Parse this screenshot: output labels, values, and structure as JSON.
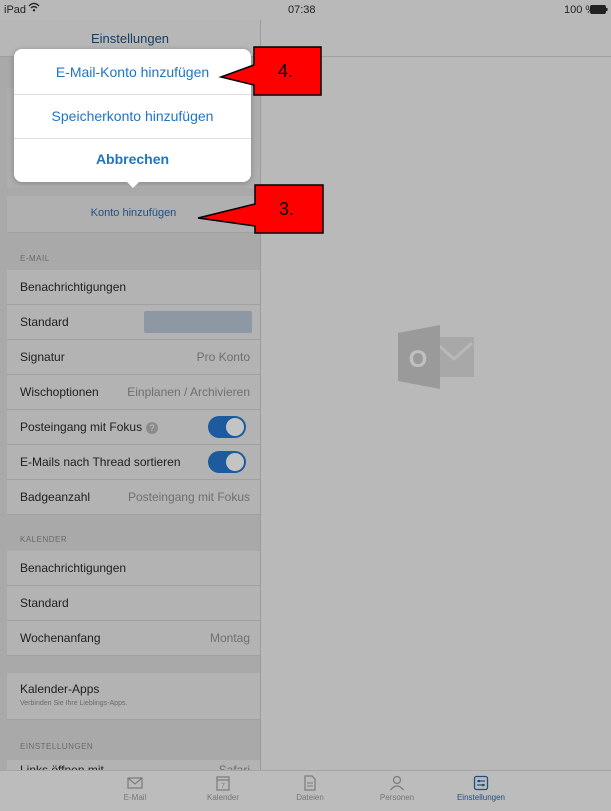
{
  "status_bar": {
    "device": "iPad",
    "time": "07:38",
    "battery": "100 %"
  },
  "header": {
    "title": "Einstellungen"
  },
  "popover": {
    "options": [
      "E-Mail-Konto hinzufügen",
      "Speicherkonto hinzufügen"
    ],
    "cancel": "Abbrechen"
  },
  "add_account": {
    "label": "Konto hinzufügen"
  },
  "email_section": {
    "title": "E-MAIL",
    "rows": {
      "notifications": "Benachrichtigungen",
      "default": "Standard",
      "signature": "Signatur",
      "signature_value": "Pro Konto",
      "swipe": "Wischoptionen",
      "swipe_value": "Einplanen / Archivieren",
      "focused": "Posteingang mit Fokus",
      "thread": "E-Mails nach Thread sortieren",
      "badge": "Badgeanzahl",
      "badge_value": "Posteingang mit Fokus"
    },
    "focused_enabled": true,
    "thread_enabled": true
  },
  "calendar_section": {
    "title": "KALENDER",
    "rows": {
      "notifications": "Benachrichtigungen",
      "default": "Standard",
      "week_start": "Wochenanfang",
      "week_start_value": "Montag"
    }
  },
  "calendar_apps": {
    "title": "Kalender-Apps",
    "subtitle": "Verbinden Sie Ihre Lieblings-Apps."
  },
  "settings_section": {
    "title": "EINSTELLUNGEN",
    "partial_label": "Links öffnen mit",
    "partial_value": "Safari"
  },
  "callouts": {
    "step3": "3.",
    "step4": "4."
  },
  "tabs": [
    {
      "label": "E-Mail",
      "icon": "mail-icon"
    },
    {
      "label": "Kalender",
      "icon": "calendar-icon"
    },
    {
      "label": "Dateien",
      "icon": "file-icon"
    },
    {
      "label": "Personen",
      "icon": "person-icon"
    },
    {
      "label": "Einstellungen",
      "icon": "settings-icon"
    }
  ],
  "calendar_icon_day": "7",
  "logo_letter": "O",
  "colors": {
    "accent": "#1f74c6",
    "toggle_on": "#1d5a9e",
    "callout": "#ff0000"
  }
}
